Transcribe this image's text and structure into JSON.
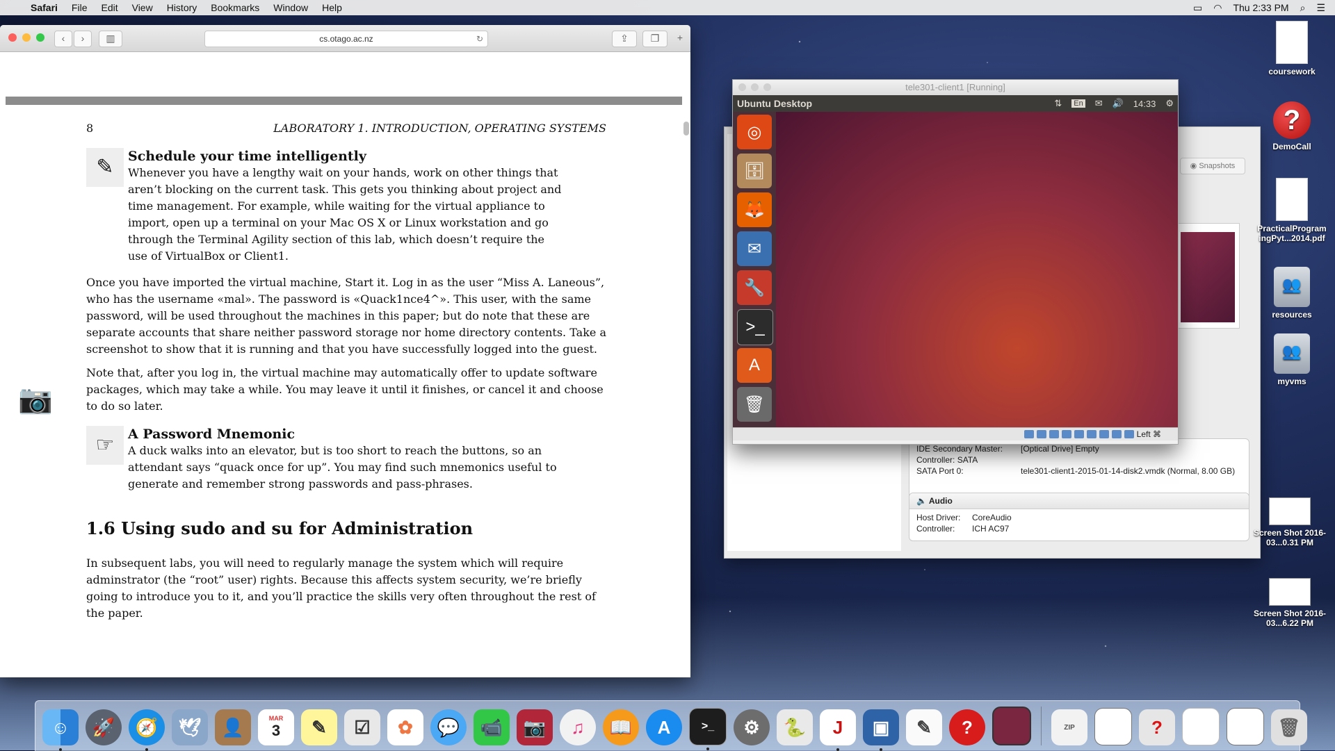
{
  "menubar": {
    "app": "Safari",
    "items": [
      "File",
      "Edit",
      "View",
      "History",
      "Bookmarks",
      "Window",
      "Help"
    ],
    "clock": "Thu 2:33 PM"
  },
  "safari": {
    "address": "cs.otago.ac.nz",
    "doc": {
      "page_number": "8",
      "running_head": "LABORATORY 1.  INTRODUCTION, OPERATING SYSTEMS",
      "note1_title": "Schedule your time intelligently",
      "note1_text": "Whenever you have a lengthy wait on your hands, work on other things that aren’t blocking on the current task. This gets you thinking about project and time management. For example, while waiting for the virtual appliance to import, open up a terminal on your Mac OS X or Linux workstation and go through the Terminal Agility section of this lab, which doesn’t require the use of VirtualBox or Client1.",
      "para1": "Once you have imported the virtual machine, Start it. Log in as the user “Miss A. Laneous”, who has the username «mal». The password is «Quack1nce4^». This user, with the same password, will be used throughout the machines in this paper; but do note that these are separate accounts that share neither password storage nor home directory contents. Take a screenshot to show that it is running and that you have successfully logged into the guest.",
      "para2": "Note that, after you log in, the virtual machine may automatically offer to update software packages, which may take a while. You may leave it until it finishes, or cancel it and choose to do so later.",
      "note2_title": "A Password Mnemonic",
      "note2_text": "A duck walks into an elevator, but is too short to reach the buttons, so an attendant says “quack once for up”. You may find such mnemonics useful to generate and remember strong passwords and pass-phrases.",
      "section_heading": "1.6   Using sudo and su for Administration",
      "para3": "In subsequent labs, you will need to regularly manage the system which will require adminstrator (the “root” user) rights. Because this affects system security, we’re briefly going to introduce you to it, and you’ll practice the skills very often throughout the rest of the paper."
    }
  },
  "vbox_manager": {
    "snapshots_label": "Snapshots",
    "storage": {
      "ide_label": "IDE Secondary Master:",
      "ide_value": "[Optical Drive] Empty",
      "controller": "Controller: SATA",
      "sata_label": "SATA Port 0:",
      "sata_value": "tele301-client1-2015-01-14-disk2.vmdk (Normal, 8.00 GB)"
    },
    "audio": {
      "title": "Audio",
      "host_driver_label": "Host Driver:",
      "host_driver_value": "CoreAudio",
      "controller_label": "Controller:",
      "controller_value": "ICH AC97"
    }
  },
  "vm": {
    "title": "tele301-client1 [Running]",
    "panel_title": "Ubuntu Desktop",
    "lang": "En",
    "time": "14:33",
    "host_key": "Left ⌘"
  },
  "desktop_icons": [
    {
      "label": "coursework"
    },
    {
      "label": "DemoCall"
    },
    {
      "label": "PracticalProgram ingPyt...2014.pdf"
    },
    {
      "label": "resources"
    },
    {
      "label": "myvms"
    },
    {
      "label": "Screen Shot 2016-03...0.31 PM"
    },
    {
      "label": "Screen Shot 2016-03...6.22 PM"
    }
  ],
  "dock": {
    "calendar_month": "MAR",
    "calendar_day": "3"
  }
}
